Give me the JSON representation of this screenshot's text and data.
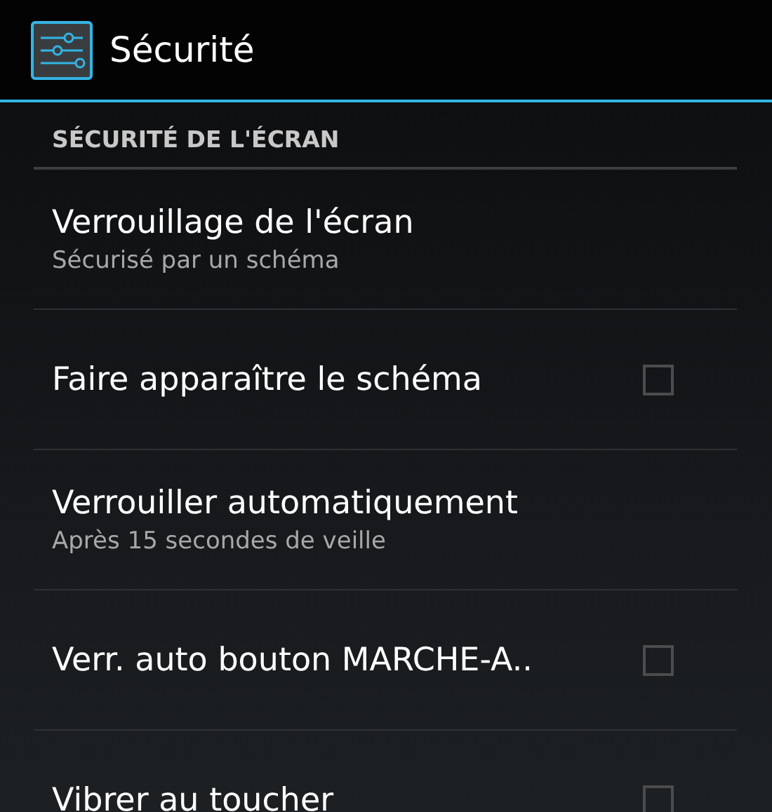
{
  "action_bar": {
    "title": "Sécurité"
  },
  "category": {
    "title": "SÉCURITÉ DE L'ÉCRAN"
  },
  "items": [
    {
      "kind": "text",
      "title": "Verrouillage de l'écran",
      "summary": "Sécurisé par un schéma"
    },
    {
      "kind": "checkbox",
      "title": "Faire apparaître le schéma",
      "checked": false
    },
    {
      "kind": "text",
      "title": "Verrouiller automatiquement",
      "summary": "Après 15 secondes de veille"
    },
    {
      "kind": "checkbox",
      "title": "Verr. auto bouton MARCHE-A..",
      "checked": false
    },
    {
      "kind": "checkbox",
      "title": "Vibrer au toucher",
      "checked": false
    }
  ]
}
